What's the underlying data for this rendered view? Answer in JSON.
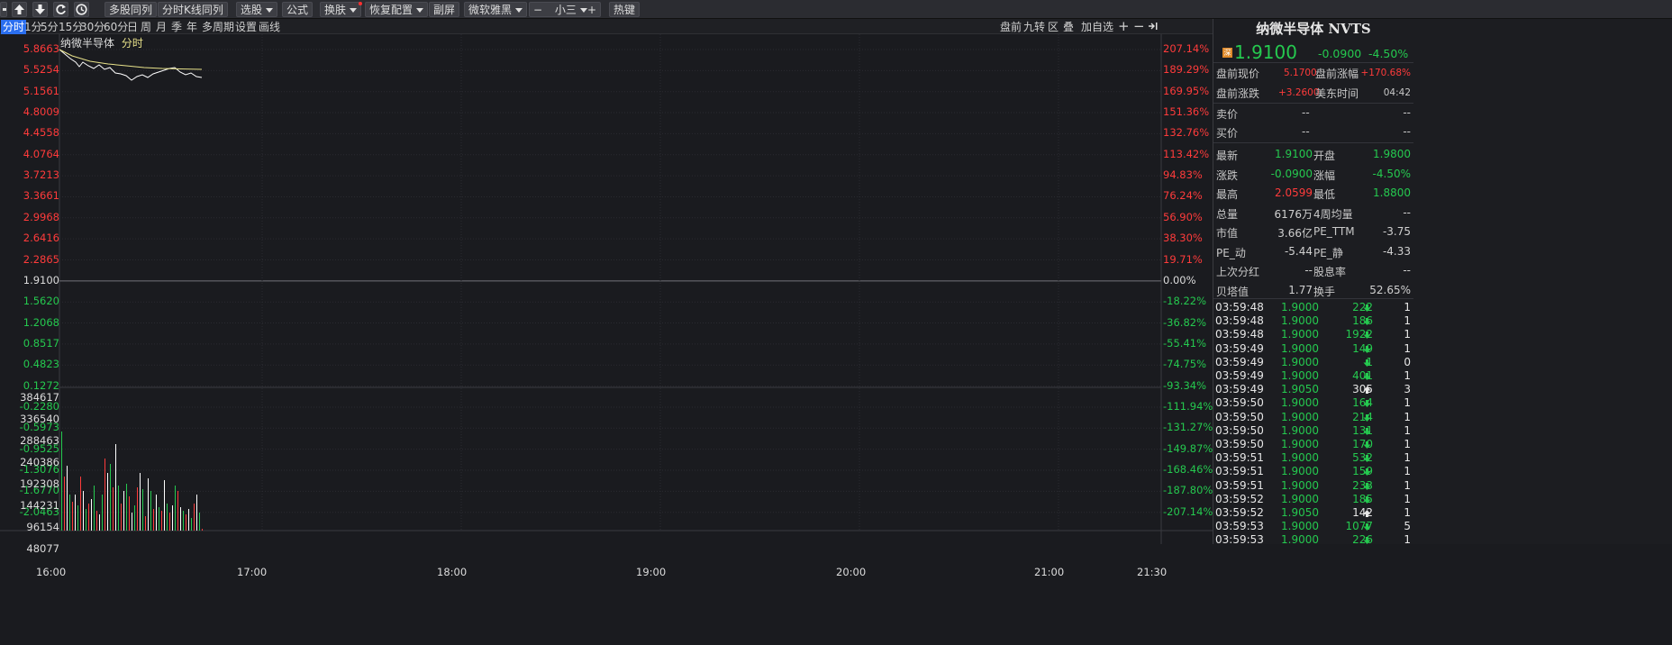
{
  "toolbar": {
    "multi_stock": "多股同列",
    "kline_same": "分时K线同列",
    "pick_stock": "选股",
    "formula": "公式",
    "skin": "换肤",
    "restore": "恢复配置",
    "sub_screen": "副屏",
    "font": "微软雅黑",
    "font_size": "小三",
    "hotkey": "热键",
    "minus": "−",
    "plus": "+"
  },
  "periods": [
    "分时",
    "1分",
    "5分",
    "15分",
    "30分",
    "60分",
    "日",
    "周",
    "月",
    "季",
    "年",
    "多周期",
    "设置",
    "画线"
  ],
  "chart_tools": {
    "premarket": "盘前",
    "nine": "九转",
    "zone": "区",
    "overlay": "叠",
    "add_fav": "加自选"
  },
  "chart": {
    "stock_name": "纳微半导体",
    "mode": "分时",
    "left_axis": [
      "5.8663",
      "5.5254",
      "5.1561",
      "4.8009",
      "4.4558",
      "4.0764",
      "3.7213",
      "3.3661",
      "2.9968",
      "2.6416",
      "2.2865",
      "1.9100",
      "1.5620",
      "1.2068",
      "0.8517",
      "0.4823",
      "0.1272",
      "-0.2280",
      "-0.5973",
      "-0.9525",
      "-1.3076",
      "-1.6770",
      "-2.0463"
    ],
    "right_axis": [
      "207.14%",
      "189.29%",
      "169.95%",
      "151.36%",
      "132.76%",
      "113.42%",
      "94.83%",
      "76.24%",
      "56.90%",
      "38.30%",
      "19.71%",
      "0.00%",
      "-18.22%",
      "-36.82%",
      "-55.41%",
      "-74.75%",
      "-93.34%",
      "-111.94%",
      "-131.27%",
      "-149.87%",
      "-168.46%",
      "-187.80%",
      "-207.14%"
    ],
    "vol_axis": [
      "384617",
      "336540",
      "288463",
      "240386",
      "192308",
      "144231",
      "96154",
      "48077"
    ],
    "time_axis": [
      "16:00",
      "17:00",
      "18:00",
      "19:00",
      "20:00",
      "21:00",
      "21:30"
    ],
    "colors": {
      "up": "#ff3b3b",
      "down": "#25c94f",
      "price_line": "#ffffff",
      "avg_line": "#e8e28a"
    }
  },
  "quote": {
    "title": "纳微半导体 NVTS",
    "badge": "深",
    "price": "1.9100",
    "change": "-0.0900",
    "change_pct": "-4.50%",
    "pre_price_label": "盘前现价",
    "pre_price": "5.1700",
    "pre_rise_label": "盘前涨幅",
    "pre_rise": "+170.68%",
    "pre_change_label": "盘前涨跌",
    "pre_change": "+3.2600",
    "us_time_label": "美东时间",
    "us_time": "04:42",
    "ask_label": "卖价",
    "ask": "--",
    "ask_vol": "--",
    "bid_label": "买价",
    "bid": "--",
    "bid_vol": "--",
    "stats": [
      {
        "l1": "最新",
        "v1": "1.9100",
        "l2": "开盘",
        "v2": "1.9800"
      },
      {
        "l1": "涨跌",
        "v1": "-0.0900",
        "l2": "涨幅",
        "v2": "-4.50%"
      },
      {
        "l1": "最高",
        "v1": "2.0599",
        "l2": "最低",
        "v2": "1.8800"
      },
      {
        "l1": "总量",
        "v1": "6176万",
        "l2": "4周均量",
        "v2": "--"
      },
      {
        "l1": "市值",
        "v1": "3.66亿",
        "l2": "PE_TTM",
        "v2": "-3.75"
      },
      {
        "l1": "PE_动",
        "v1": "-5.44",
        "l2": "PE_静",
        "v2": "-4.33"
      },
      {
        "l1": "上次分红",
        "v1": "--",
        "l2": "股息率",
        "v2": "--"
      },
      {
        "l1": "贝塔值",
        "v1": "1.77",
        "l2": "换手",
        "v2": "52.65%"
      }
    ]
  },
  "ticks": [
    {
      "t": "03:59:48",
      "p": "1.9000",
      "v": "222",
      "d": "down",
      "n": "1"
    },
    {
      "t": "03:59:48",
      "p": "1.9000",
      "v": "186",
      "d": "down",
      "n": "1"
    },
    {
      "t": "03:59:48",
      "p": "1.9000",
      "v": "1922",
      "d": "down",
      "n": "1"
    },
    {
      "t": "03:59:49",
      "p": "1.9000",
      "v": "149",
      "d": "down",
      "n": "1"
    },
    {
      "t": "03:59:49",
      "p": "1.9000",
      "v": "1",
      "d": "down",
      "n": "0"
    },
    {
      "t": "03:59:49",
      "p": "1.9000",
      "v": "401",
      "d": "down",
      "n": "1"
    },
    {
      "t": "03:59:49",
      "p": "1.9050",
      "v": "305",
      "d": "up",
      "n": "3"
    },
    {
      "t": "03:59:50",
      "p": "1.9000",
      "v": "164",
      "d": "down",
      "n": "1"
    },
    {
      "t": "03:59:50",
      "p": "1.9000",
      "v": "214",
      "d": "down",
      "n": "1"
    },
    {
      "t": "03:59:50",
      "p": "1.9000",
      "v": "131",
      "d": "down",
      "n": "1"
    },
    {
      "t": "03:59:50",
      "p": "1.9000",
      "v": "170",
      "d": "down",
      "n": "1"
    },
    {
      "t": "03:59:51",
      "p": "1.9000",
      "v": "532",
      "d": "down",
      "n": "1"
    },
    {
      "t": "03:59:51",
      "p": "1.9000",
      "v": "159",
      "d": "down",
      "n": "1"
    },
    {
      "t": "03:59:51",
      "p": "1.9000",
      "v": "233",
      "d": "down",
      "n": "1"
    },
    {
      "t": "03:59:52",
      "p": "1.9000",
      "v": "185",
      "d": "down",
      "n": "1"
    },
    {
      "t": "03:59:52",
      "p": "1.9050",
      "v": "142",
      "d": "up",
      "n": "1"
    },
    {
      "t": "03:59:53",
      "p": "1.9000",
      "v": "1077",
      "d": "down",
      "n": "5"
    },
    {
      "t": "03:59:53",
      "p": "1.9000",
      "v": "226",
      "d": "down",
      "n": "1"
    }
  ]
}
